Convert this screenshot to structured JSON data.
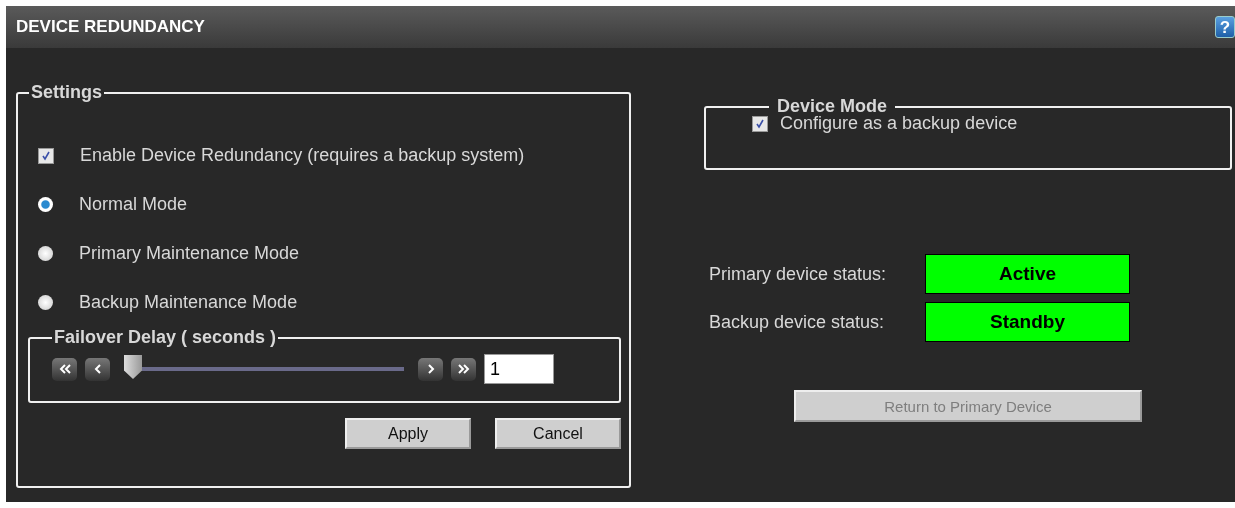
{
  "header": {
    "title": "DEVICE REDUNDANCY",
    "help": "?"
  },
  "settings": {
    "legend": "Settings",
    "enable": {
      "label": "Enable Device Redundancy (requires a backup system)",
      "checked": true
    },
    "modes": [
      {
        "label": "Normal Mode",
        "selected": true
      },
      {
        "label": "Primary Maintenance Mode",
        "selected": false
      },
      {
        "label": "Backup Maintenance Mode",
        "selected": false
      }
    ],
    "failover": {
      "legend": "Failover Delay ( seconds )",
      "level": 0,
      "value": "1"
    },
    "buttons": [
      {
        "label": "Apply"
      },
      {
        "label": "Cancel"
      }
    ]
  },
  "device_mode": {
    "legend": "Device Mode",
    "backup": {
      "label": "Configure as a backup device",
      "checked": true
    }
  },
  "statuses": [
    {
      "label": "Primary device status:",
      "value": "Active",
      "color": "#00ff00"
    },
    {
      "label": "Backup device status:",
      "value": "Standby",
      "color": "#00ff00"
    }
  ],
  "return_button": {
    "label": "Return to Primary Device",
    "disabled": true
  }
}
